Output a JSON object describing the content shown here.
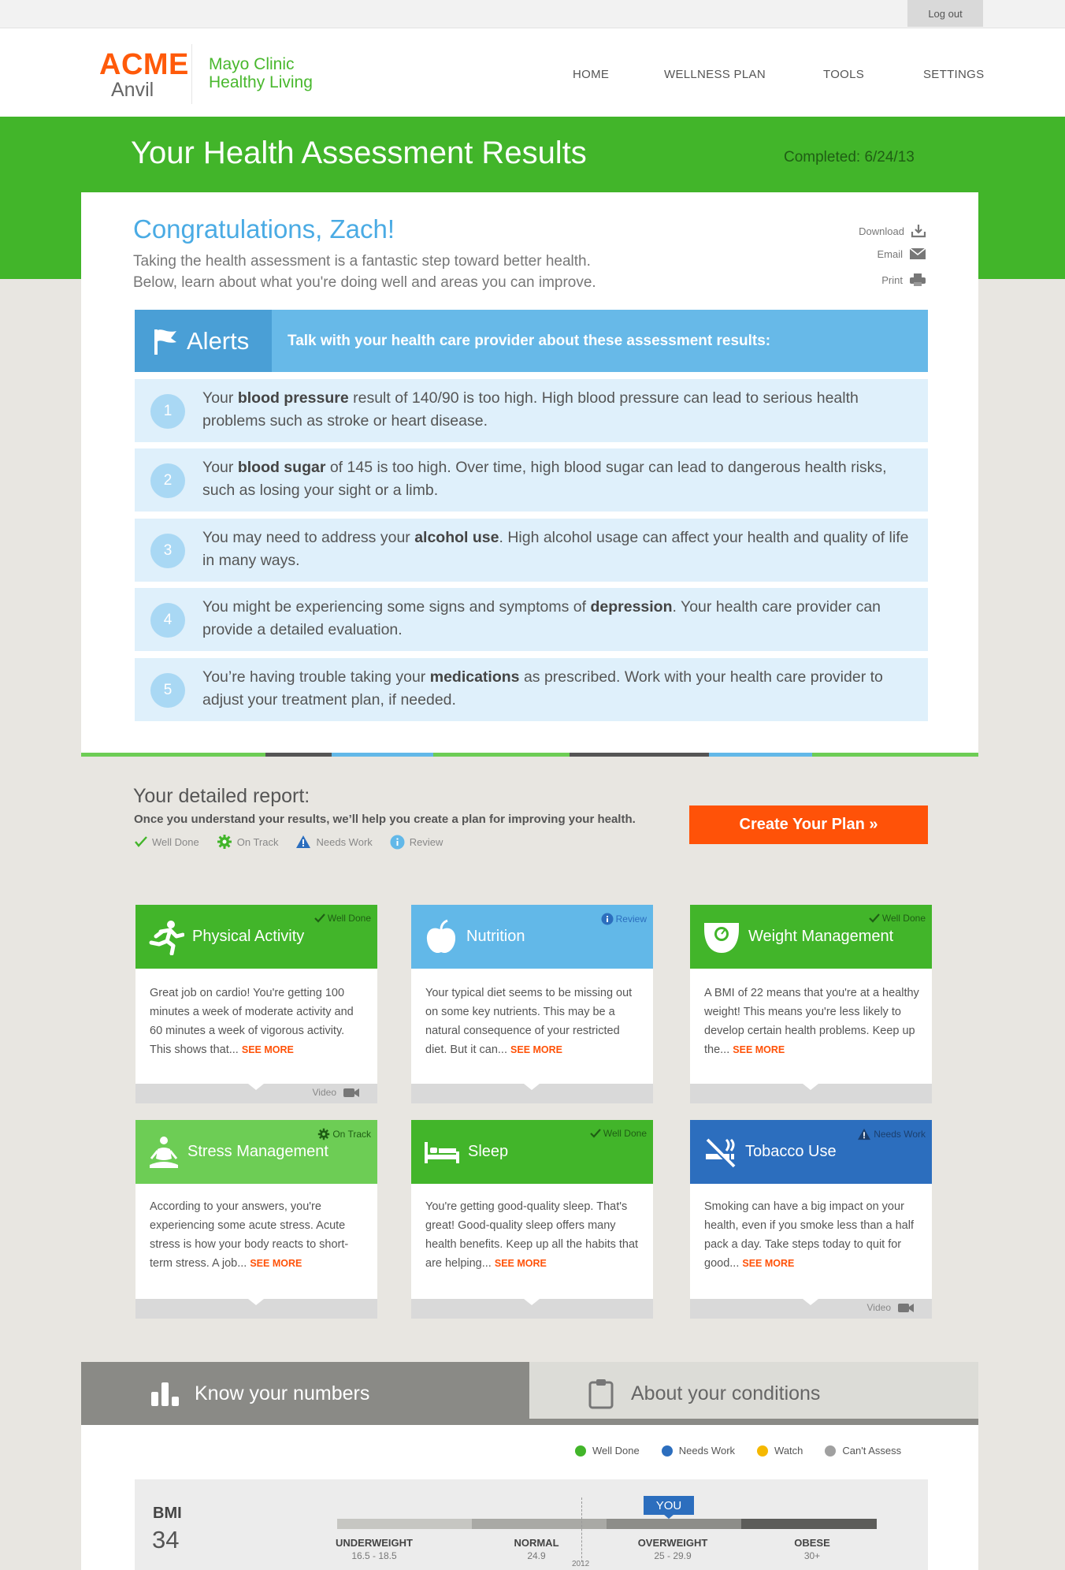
{
  "topbar": {
    "logout": "Log out"
  },
  "brand": {
    "acme": "ACME",
    "anvil": "Anvil",
    "partner_line1": "Mayo Clinic",
    "partner_line2": "Healthy Living"
  },
  "nav": [
    "HOME",
    "WELLNESS PLAN",
    "TOOLS",
    "SETTINGS"
  ],
  "banner": {
    "title": "Your Health Assessment Results",
    "completed": "Completed: 6/24/13"
  },
  "intro": {
    "greeting": "Congratulations, Zach!",
    "line1": "Taking the health assessment is a fantastic step toward better health.",
    "line2": "Below, learn about what you're doing well and areas you can improve."
  },
  "actions": {
    "download": "Download",
    "email": "Email",
    "print": "Print"
  },
  "alerts": {
    "tab_label": "Alerts",
    "message": "Talk with your health care provider about these assessment results:",
    "items": [
      {
        "num": "1",
        "pre": "Your ",
        "bold": "blood pressure",
        "post": " result of 140/90 is too high. High blood pressure can lead to serious health problems such as stroke or heart disease."
      },
      {
        "num": "2",
        "pre": "Your ",
        "bold": "blood sugar",
        "post": " of 145 is too high. Over time, high blood sugar can lead to dangerous health risks, such as losing your sight or a limb."
      },
      {
        "num": "3",
        "pre": "You may need to address your ",
        "bold": "alcohol use",
        "post": ". High alcohol usage can affect your health and quality of life in many ways."
      },
      {
        "num": "4",
        "pre": "You might be experiencing some signs and symptoms of ",
        "bold": "depression",
        "post": ". Your health care provider can provide a detailed evaluation."
      },
      {
        "num": "5",
        "pre": "You’re having trouble taking your ",
        "bold": "medications",
        "post": " as prescribed. Work with your health care provider to adjust your treatment plan, if needed."
      }
    ]
  },
  "report": {
    "title": "Your detailed report:",
    "subtitle": "Once you understand your results, we’ll help you create a plan for improving your health.",
    "legend": [
      "Well Done",
      "On Track",
      "Needs Work",
      "Review"
    ],
    "cta": "Create Your Plan »"
  },
  "tiles": [
    {
      "title": "Physical Activity",
      "status": "Well Done",
      "body": "Great job on cardio! You're getting 100 minutes a week of moderate activity and 60 minutes a week of vigorous activity. This shows that...",
      "more": "SEE MORE",
      "video": "Video",
      "color": "#42b52a"
    },
    {
      "title": "Nutrition",
      "status": "Review",
      "body": "Your typical diet seems to be missing out on some key nutrients. This may be a natural consequence of your restricted diet. But it can...",
      "more": "SEE MORE",
      "video": "",
      "color": "#62b8e8"
    },
    {
      "title": "Weight Management",
      "status": "Well Done",
      "body": "A BMI of 22 means that you're at a healthy weight! This means you're less likely to develop certain health problems. Keep up the...",
      "more": "SEE MORE",
      "video": "",
      "color": "#42b52a"
    },
    {
      "title": "Stress Management",
      "status": "On Track",
      "body": "According to your answers, you're experiencing some acute stress. Acute stress is how your body reacts to short-term stress. A job...",
      "more": "SEE MORE",
      "video": "",
      "color": "#6dcd55"
    },
    {
      "title": "Sleep",
      "status": "Well Done",
      "body": "You're getting good-quality sleep. That's great! Good-quality sleep offers many health benefits. Keep up all the habits that are helping...",
      "more": "SEE MORE",
      "video": "",
      "color": "#42b52a"
    },
    {
      "title": "Tobacco Use",
      "status": "Needs Work",
      "body": "Smoking can have a big impact on your health, even if you smoke less than a half pack a day. Take steps today to quit for good...",
      "more": "SEE MORE",
      "video": "Video",
      "color": "#2c6ebe"
    }
  ],
  "bottom_tabs": {
    "numbers": "Know your numbers",
    "conditions": "About your conditions"
  },
  "number_legend": [
    {
      "label": "Well Done",
      "color": "#42b52a"
    },
    {
      "label": "Needs Work",
      "color": "#2c6ebe"
    },
    {
      "label": "Watch",
      "color": "#f5b800"
    },
    {
      "label": "Can't Assess",
      "color": "#a0a0a0"
    }
  ],
  "bmi": {
    "label": "BMI",
    "value": "34",
    "you": "YOU",
    "year": "2012",
    "segments": [
      {
        "name": "UNDERWEIGHT",
        "range": "16.5 - 18.5"
      },
      {
        "name": "NORMAL",
        "range": "24.9"
      },
      {
        "name": "OVERWEIGHT",
        "range": "25 - 29.9"
      },
      {
        "name": "OBESE",
        "range": "30+"
      }
    ]
  }
}
